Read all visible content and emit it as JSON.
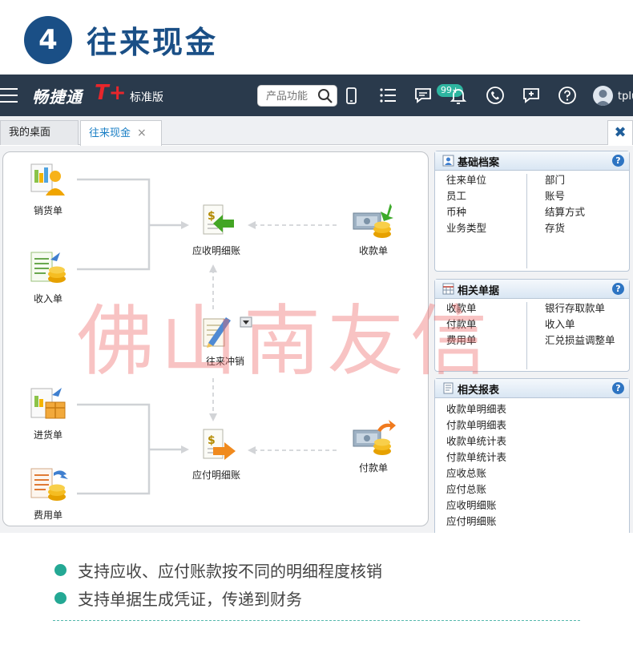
{
  "hero": {
    "number": "4",
    "title": "往来现金"
  },
  "topbar": {
    "brand": "畅捷通",
    "brand_mark": "T+",
    "edition": "标准版",
    "search_placeholder": "产品功能",
    "badge_count": "99+",
    "user": "tplu"
  },
  "tabs": [
    {
      "label": "我的桌面"
    },
    {
      "label": "往来现金",
      "close": "×"
    }
  ],
  "close_all": "✖",
  "flow": {
    "nodes": [
      {
        "key": "sales",
        "label": "销货单"
      },
      {
        "key": "income",
        "label": "收入单"
      },
      {
        "key": "receivable_detail",
        "label": "应收明细账"
      },
      {
        "key": "receipt",
        "label": "收款单"
      },
      {
        "key": "writeoff",
        "label": "往来冲销"
      },
      {
        "key": "purchase",
        "label": "进货单"
      },
      {
        "key": "expense",
        "label": "费用单"
      },
      {
        "key": "payable_detail",
        "label": "应付明细账"
      },
      {
        "key": "payment",
        "label": "付款单"
      }
    ]
  },
  "panels": {
    "basic": {
      "title": "基础档案",
      "left": [
        "往来单位",
        "员工",
        "币种",
        "业务类型"
      ],
      "right": [
        "部门",
        "账号",
        "结算方式",
        "存货"
      ]
    },
    "docs": {
      "title": "相关单据",
      "left": [
        "收款单",
        "付款单",
        "费用单"
      ],
      "right": [
        "银行存取款单",
        "收入单",
        "汇兑损益调整单"
      ]
    },
    "reports": {
      "title": "相关报表",
      "items": [
        "收款单明细表",
        "付款单明细表",
        "收款单统计表",
        "付款单统计表",
        "应收总账",
        "应付总账",
        "应收明细账",
        "应付明细账"
      ]
    }
  },
  "watermark": "佛山南友信",
  "bullets": [
    "支持应收、应付账款按不同的明细程度核销",
    "支持单据生成凭证，传递到财务"
  ],
  "colors": {
    "accent": "#1a4f86",
    "topbar": "#2a3a4c",
    "bullet": "#24a894",
    "watermark": "#ec6060"
  }
}
